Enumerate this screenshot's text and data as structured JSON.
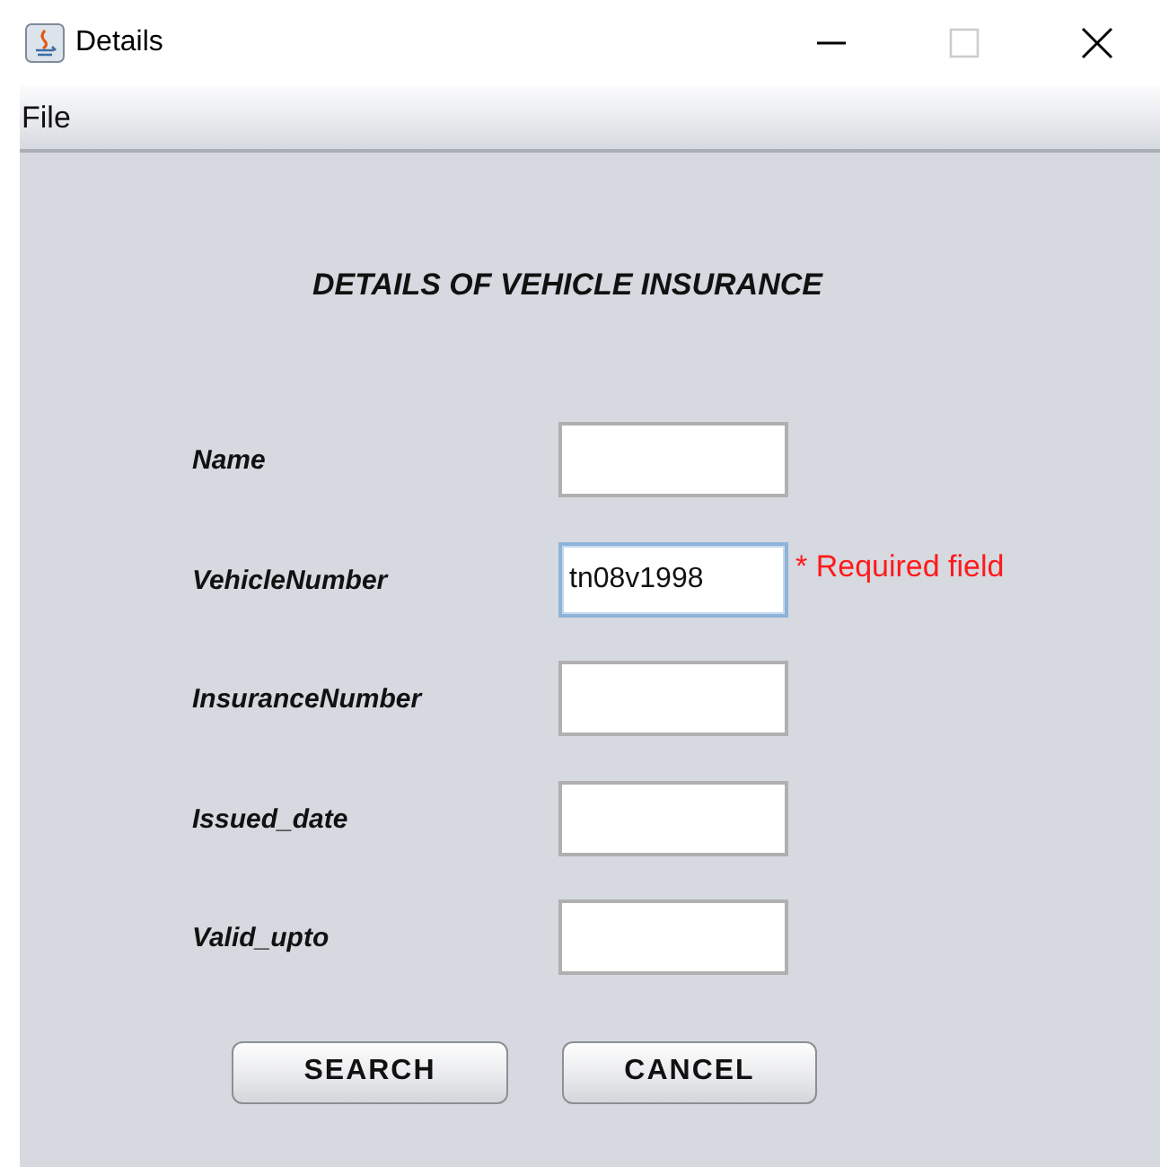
{
  "window": {
    "title": "Details"
  },
  "menu": [
    "File"
  ],
  "heading": "DETAILS OF VEHICLE INSURANCE",
  "fields": [
    {
      "label": "Name",
      "focused": false
    },
    {
      "label": "VehicleNumber",
      "value": "tn08v1998",
      "focused": true,
      "error": "* Required field"
    },
    {
      "label": "InsuranceNumber",
      "focused": false
    },
    {
      "label": "Issued_date",
      "focused": false
    },
    {
      "label": "Valid_upto",
      "focused": false
    }
  ],
  "buttons": [
    "SEARCH",
    "CANCEL"
  ]
}
